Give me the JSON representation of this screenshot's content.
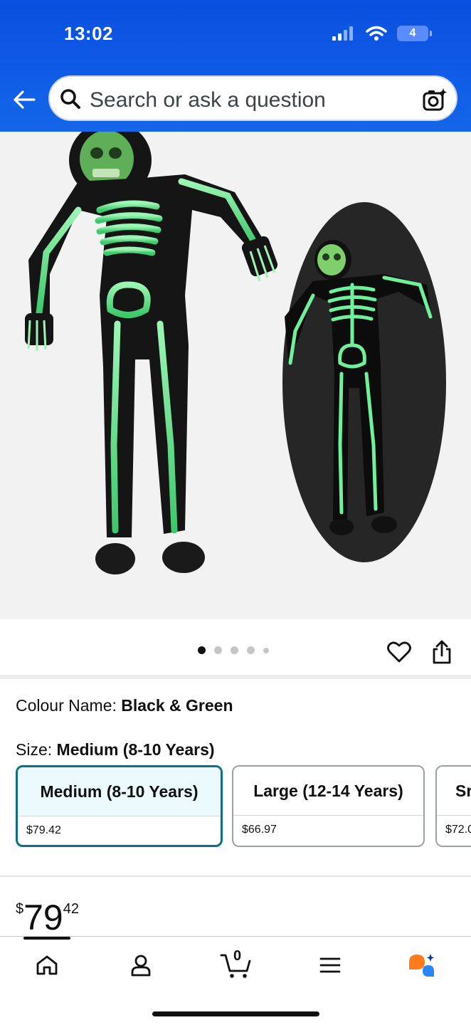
{
  "status_bar": {
    "time": "13:02",
    "battery": "4"
  },
  "search": {
    "placeholder": "Search or ask a question"
  },
  "gallery": {
    "image_count": 5,
    "active_index": 0
  },
  "product": {
    "colour_label": "Colour Name:",
    "colour_value": "Black & Green",
    "size_label": "Size:",
    "size_value": "Medium (8-10 Years)",
    "sizes": [
      {
        "name": "Medium (8-10 Years)",
        "price": "$79.42",
        "selected": true
      },
      {
        "name": "Large (12-14 Years)",
        "price": "$66.97",
        "selected": false
      },
      {
        "name": "Sr",
        "price": "$72.0",
        "selected": false
      }
    ],
    "price": {
      "symbol": "$",
      "whole": "79",
      "fraction": "42"
    }
  },
  "colors": {
    "header": "#0a4fe0",
    "selected_border": "#0e6e84",
    "glow_green": "#5ee58a"
  },
  "icons": [
    "arrow-left-icon",
    "search-icon",
    "camera-icon",
    "heart-icon",
    "share-icon",
    "home-icon",
    "user-icon",
    "cart-icon",
    "menu-icon",
    "rufus-icon"
  ],
  "nav": {
    "cart_count": "0"
  }
}
